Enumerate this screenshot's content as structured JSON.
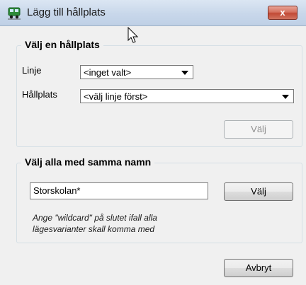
{
  "window": {
    "title": "Lägg till hållplats",
    "close_label": "x"
  },
  "group_stop": {
    "legend": "Välj en hållplats",
    "line_label": "Linje",
    "line_value": "<inget valt>",
    "stop_label": "Hållplats",
    "stop_value": "<välj linje först>",
    "select_button": "Välj"
  },
  "group_name": {
    "legend": "Välj alla med samma namn",
    "name_value": "Storskolan*",
    "select_button": "Välj",
    "hint_line1": "Ange \"wildcard\" på slutet ifall alla",
    "hint_line2": "lägesvarianter skall komma med"
  },
  "footer": {
    "cancel_button": "Avbryt"
  },
  "colors": {
    "window_bg": "#f0f0f0",
    "close_button": "#c24a35",
    "bus_icon": "#2e8b3a"
  },
  "icons": {
    "title": "bus-icon",
    "close": "close-icon",
    "cursor": "mouse-pointer-icon"
  }
}
